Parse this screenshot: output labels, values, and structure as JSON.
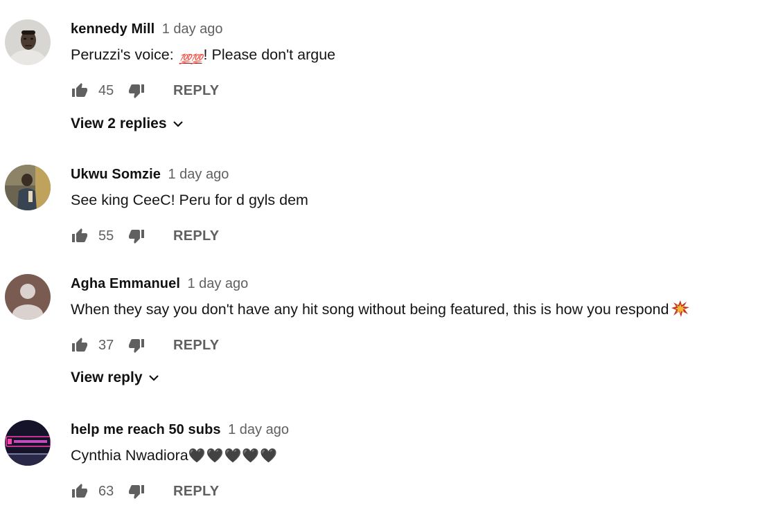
{
  "colors": {
    "author": "#111111",
    "meta": "#606060",
    "text": "#151515",
    "icon": "#606060",
    "emoji_100": "#a01818"
  },
  "actions": {
    "reply_label": "REPLY",
    "like_icon": "thumb-up-icon",
    "dislike_icon": "thumb-down-icon"
  },
  "comments": [
    {
      "author": "kennedy Mill",
      "time": "1 day ago",
      "text_before": "Peruzzi's voice: ",
      "emoji": "💯💯",
      "text_after": "! Please don't argue",
      "likes": "45",
      "view_replies": "View 2 replies"
    },
    {
      "author": "Ukwu Somzie",
      "time": "1 day ago",
      "text": "See king CeeC! Peru for d gyls dem",
      "likes": "55"
    },
    {
      "author": "Agha Emmanuel",
      "time": "1 day ago",
      "text": "When they say you don't have any hit song without being featured, this is how you respond",
      "emoji": "💥",
      "likes": "37",
      "view_replies": "View reply"
    },
    {
      "author": "help me reach 50 subs",
      "time": "1 day ago",
      "text": "Cynthia Nwadiora",
      "emoji": "🖤🖤🖤🖤🖤",
      "likes": "63"
    }
  ]
}
